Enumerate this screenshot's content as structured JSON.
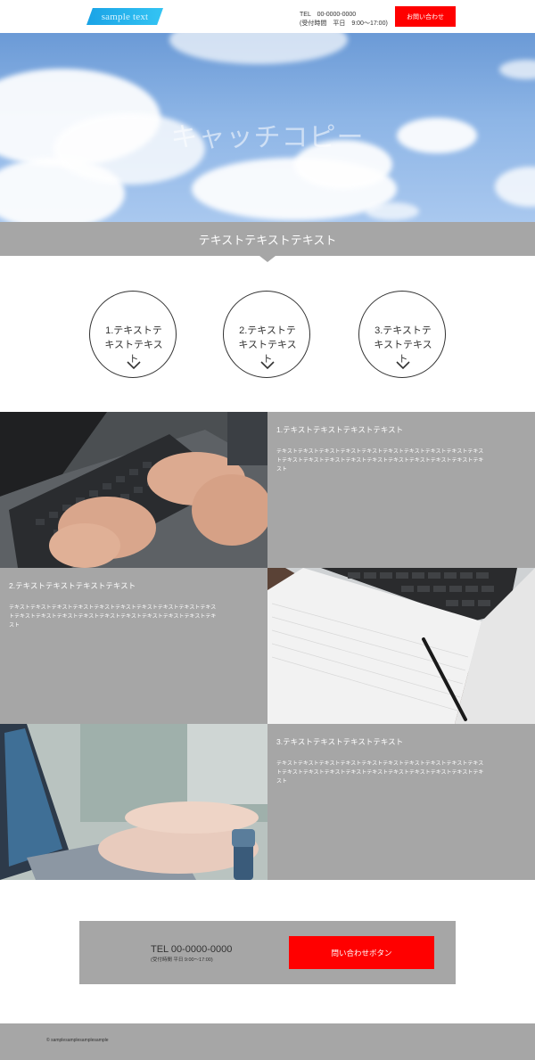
{
  "header": {
    "logo_text": "sample text",
    "tel": "TEL　00-0000-0000",
    "hours": "(受付時間　平日　9:00～17:00)",
    "contact_button": "お問い合わせ"
  },
  "hero": {
    "catch_copy": "キャッチコピー"
  },
  "band": {
    "text": "テキストテキストテキスト"
  },
  "circles": [
    {
      "text": "1.テキストテキストテキスト",
      "icon": "chevron-down-icon"
    },
    {
      "text": "2.テキストテキストテキスト",
      "icon": "chevron-down-icon"
    },
    {
      "text": "3.テキストテキストテキスト",
      "icon": "chevron-down-icon"
    }
  ],
  "features": [
    {
      "title": "1.テキストテキストテキストテキスト",
      "body": "テキストテキストテキストテキストテキストテキストテキストテキストテキストテキストテキストテキストテキストテキストテキストテキストテキストテキストテキストテキスト",
      "image": "tablet keyboard typing photo"
    },
    {
      "title": "2.テキストテキストテキストテキスト",
      "body": "テキストテキストテキストテキストテキストテキストテキストテキストテキストテキストテキストテキストテキストテキストテキストテキストテキストテキストテキストテキスト",
      "image": "notebook laptop pen photo"
    },
    {
      "title": "3.テキストテキストテキストテキスト",
      "body": "テキストテキストテキストテキストテキストテキストテキストテキストテキストテキストテキストテキストテキストテキストテキストテキストテキストテキストテキストテキスト",
      "image": "laptop typing photo"
    }
  ],
  "cta": {
    "tel": "TEL 00-0000-0000",
    "hours": "(受付時間 平日 9:00～17:00)",
    "button": "問い合わせボタン"
  },
  "footer": {
    "copyright": "© samplesamplesamplesample"
  },
  "colors": {
    "accent_red": "#ff0000",
    "gray": "#a6a6a6",
    "logo_blue": "#1aa3e6"
  }
}
